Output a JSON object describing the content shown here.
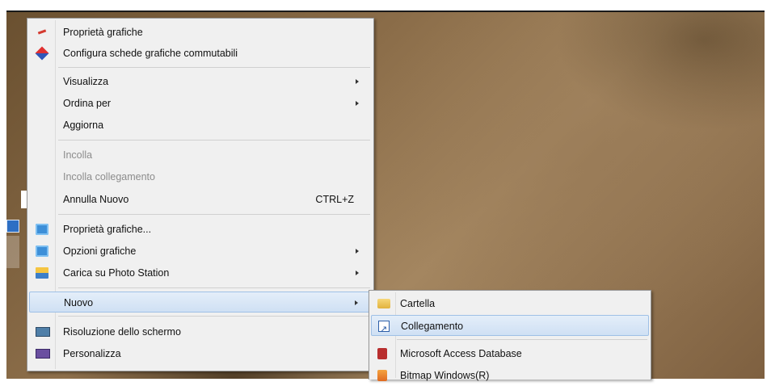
{
  "context_menu": {
    "items": [
      {
        "label": "Proprietà grafiche",
        "icon": "graphics-properties-icon"
      },
      {
        "label": "Configura schede grafiche commutabili",
        "icon": "switchable-graphics-icon"
      },
      {
        "label": "Visualizza",
        "submenu": true
      },
      {
        "label": "Ordina per",
        "submenu": true
      },
      {
        "label": "Aggiorna"
      },
      {
        "label": "Incolla",
        "disabled": true
      },
      {
        "label": "Incolla collegamento",
        "disabled": true
      },
      {
        "label": "Annulla Nuovo",
        "shortcut": "CTRL+Z"
      },
      {
        "label": "Proprietà grafiche...",
        "icon": "intel-graphics-icon"
      },
      {
        "label": "Opzioni grafiche",
        "icon": "intel-graphics-icon",
        "submenu": true
      },
      {
        "label": "Carica su Photo Station",
        "icon": "photo-station-icon",
        "submenu": true
      },
      {
        "label": "Nuovo",
        "submenu": true,
        "highlighted": true
      },
      {
        "label": "Risoluzione dello schermo",
        "icon": "monitor-icon"
      },
      {
        "label": "Personalizza",
        "icon": "personalize-icon"
      }
    ]
  },
  "new_submenu": {
    "items": [
      {
        "label": "Cartella",
        "icon": "folder-icon"
      },
      {
        "label": "Collegamento",
        "icon": "shortcut-icon",
        "highlighted": true
      },
      {
        "label": "Microsoft Access Database",
        "icon": "access-icon"
      },
      {
        "label": "Bitmap Windows(R)",
        "icon": "bitmap-icon"
      }
    ]
  },
  "colors": {
    "menu_bg": "#f0f0f0",
    "highlight": "#cfe0f4",
    "disabled_text": "#8c8c8c"
  }
}
